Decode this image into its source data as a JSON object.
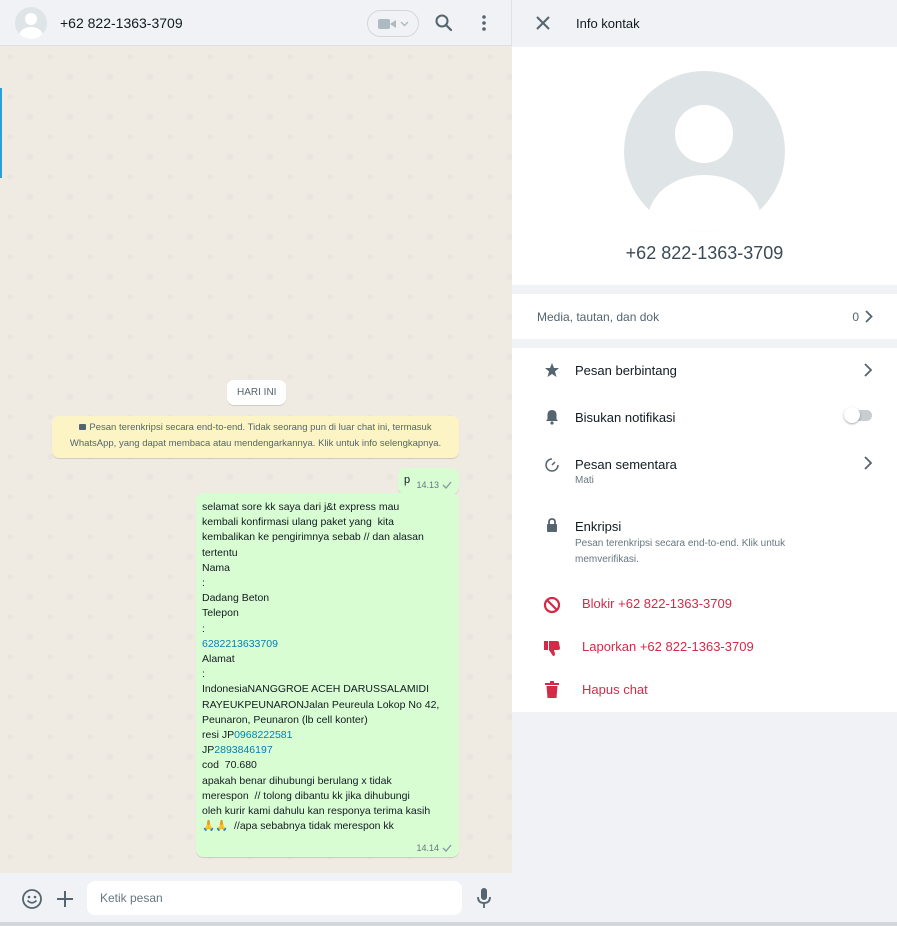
{
  "chat": {
    "contact_name": "+62 822-1363-3709",
    "day_chip": "HARI INI",
    "encryption_notice": "Pesan terenkripsi secara end-to-end. Tidak seorang pun di luar chat ini, termasuk WhatsApp, yang dapat membaca atau mendengarkannya. Klik untuk info selengkapnya.",
    "messages": [
      {
        "text": "p",
        "time": "14.13"
      },
      {
        "time": "14.14",
        "lines": [
          "selamat sore kk saya dari j&t express mau",
          "kembali konfirmasi ulang paket yang  kita",
          "kembalikan ke pengirimnya sebab // dan alasan",
          "tertentu",
          "Nama",
          ":",
          "Dadang Beton",
          "Telepon",
          ":",
          "6282213633709",
          "Alamat",
          ":",
          "IndonesiaNANGGROE ACEH DARUSSALAMIDI",
          "RAYEUKPEUNARONJalan Peureula Lokop No 42,",
          "Peunaron, Peunaron (lb cell konter)",
          "resi JP",
          "0968222581",
          "JP",
          "2893846197",
          "cod  70.680",
          "apakah benar dihubungi berulang x tidak",
          "merespon  // tolong dibantu kk jika dihubungi",
          "oleh kurir kami dahulu kan responya terima kasih",
          "🙏🙏",
          "  //apa sebabnya tidak merespon kk"
        ]
      }
    ],
    "input_placeholder": "Ketik pesan"
  },
  "info": {
    "title": "Info kontak",
    "contact_name": "+62 822-1363-3709",
    "media_label": "Media, tautan, dan dok",
    "media_count": "0",
    "starred_label": "Pesan berbintang",
    "mute_label": "Bisukan notifikasi",
    "mute_on": false,
    "disappearing_label": "Pesan sementara",
    "disappearing_value": "Mati",
    "encryption_label": "Enkripsi",
    "encryption_sub": "Pesan terenkripsi secara end-to-end. Klik untuk memverifikasi.",
    "block_label": "Blokir +62 822-1363-3709",
    "report_label": "Laporkan +62 822-1363-3709",
    "delete_label": "Hapus chat"
  },
  "colors": {
    "outgoing_bubble": "#d9fdd3",
    "danger": "#d42a48",
    "link": "#027eb5",
    "notice_bg": "#fdf4c5"
  }
}
